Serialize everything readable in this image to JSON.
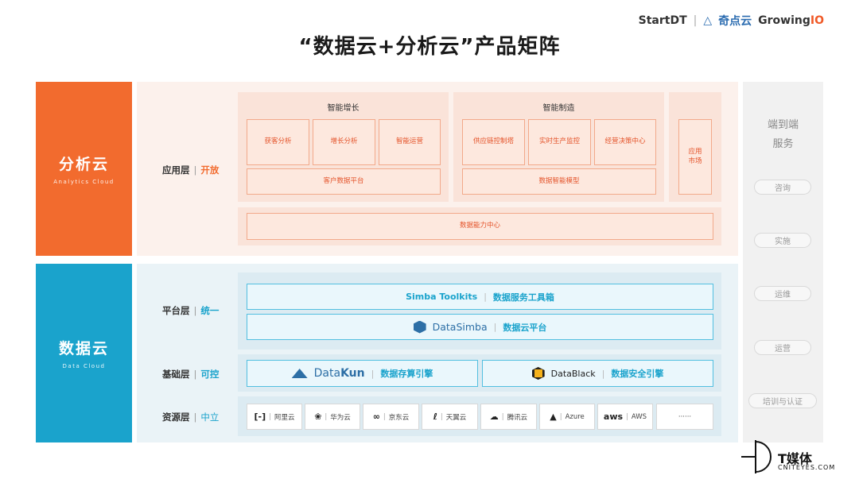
{
  "header": {
    "brand_startdt": "StartDT",
    "brand_qdy": "奇点云",
    "brand_growing": "Growing",
    "brand_io": "IO",
    "title": "“数据云+分析云”产品矩阵"
  },
  "analytics_cloud": {
    "name": "分析云",
    "name_en": "Analytics Cloud",
    "layer_label": "应用层",
    "layer_tag": "开放",
    "groups": {
      "growth": {
        "title": "智能增长",
        "items": [
          "获客分析",
          "增长分析",
          "智能运营"
        ],
        "platform": "客户数据平台"
      },
      "manufacturing": {
        "title": "智能制造",
        "items": [
          "供应链控制塔",
          "实时生产监控",
          "经营决策中心"
        ],
        "platform": "数据智能模型"
      },
      "market": {
        "label": "应用\n市场"
      }
    },
    "capability_center": "数据能力中心"
  },
  "data_cloud": {
    "name": "数据云",
    "name_en": "Data Cloud",
    "platform_layer": {
      "label": "平台层",
      "tag": "统一"
    },
    "base_layer": {
      "label": "基础层",
      "tag": "可控"
    },
    "resource_layer": {
      "label": "资源层",
      "tag": "中立"
    },
    "simba_toolkits": {
      "name": "Simba Toolkits",
      "desc": "数据服务工具箱"
    },
    "datasimba": {
      "name_a": "Data",
      "name_b": "Simba",
      "desc": "数据云平台"
    },
    "datakun": {
      "name_a": "Data",
      "name_b": "Kun",
      "desc": "数据存算引擎"
    },
    "datablack": {
      "name": "DataBlack",
      "desc": "数据安全引擎"
    },
    "resources": [
      {
        "icon": "[-]",
        "label": "阿里云"
      },
      {
        "icon": "❀",
        "label": "华为云"
      },
      {
        "icon": "∞",
        "label": "京东云"
      },
      {
        "icon": "ℓ",
        "label": "天翼云"
      },
      {
        "icon": "☁",
        "label": "腾讯云"
      },
      {
        "icon": "▲",
        "label": "Azure"
      },
      {
        "icon": "aws",
        "label": "AWS"
      },
      {
        "icon": "",
        "label": "······"
      }
    ]
  },
  "services": {
    "title_line1": "端到端",
    "title_line2": "服务",
    "items": [
      "咨询",
      "实施",
      "运维",
      "运营",
      "培训与认证"
    ]
  },
  "watermark": {
    "name": "T媒体",
    "url": "CNITEYES.COM"
  },
  "colors": {
    "orange": "#f26b2e",
    "blue": "#1aa3cc"
  }
}
